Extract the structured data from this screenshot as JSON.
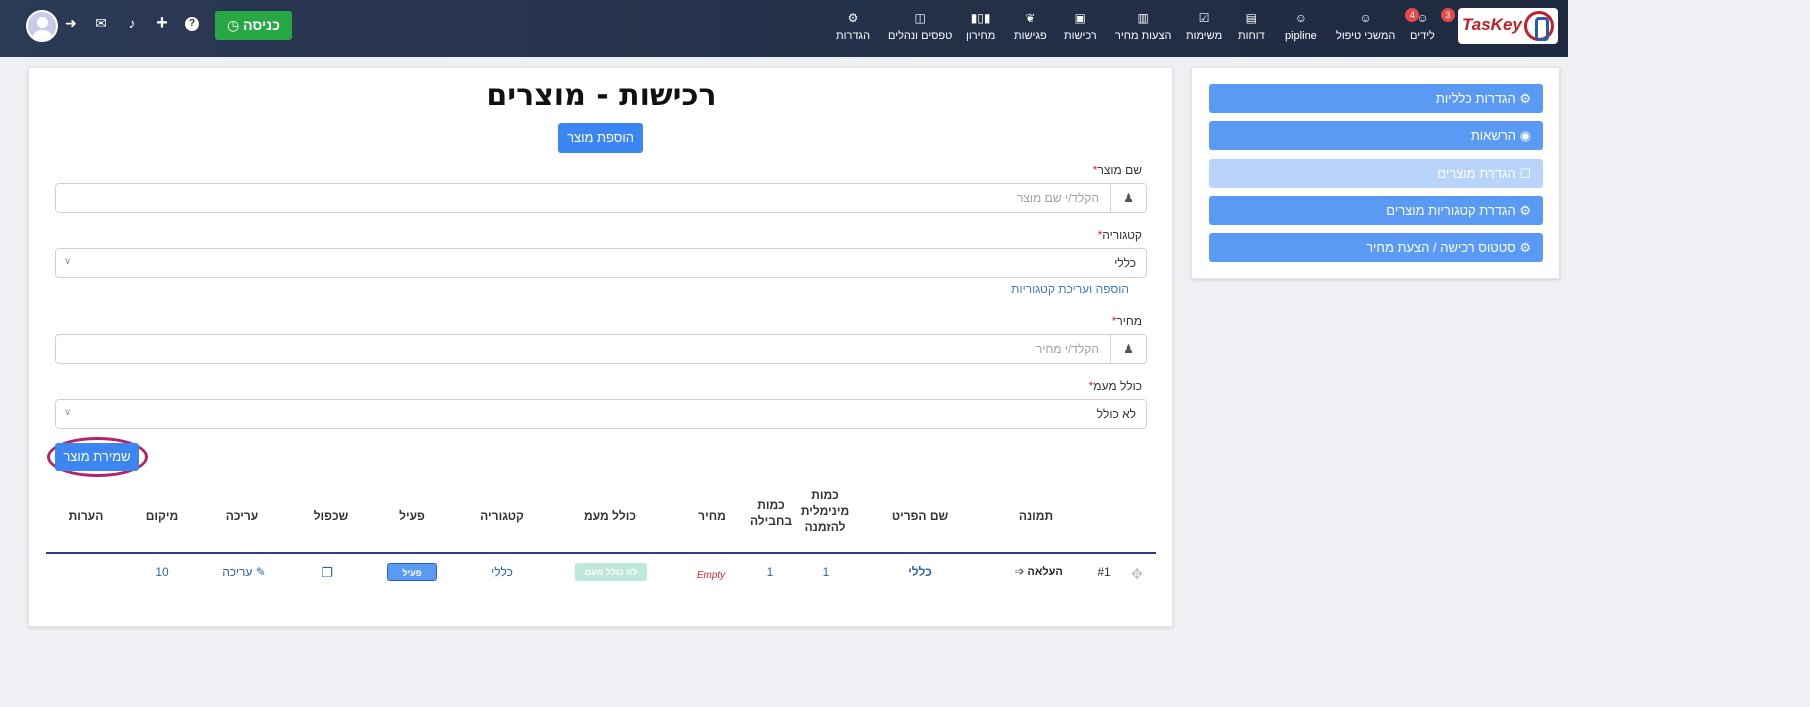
{
  "brand": {
    "logo_text": "TasKey"
  },
  "nav": {
    "items": [
      {
        "label": "לידים",
        "icon": "user-tie-icon",
        "badge": "3"
      },
      {
        "label": "המשכי טיפול",
        "icon": "user-tie-icon",
        "badge": "4"
      },
      {
        "label": "pipline",
        "icon": "user-tie-icon"
      },
      {
        "label": "דוחות",
        "icon": "bar-chart-icon"
      },
      {
        "label": "משימות",
        "icon": "checkbox-icon"
      },
      {
        "label": "הצעות מחיר",
        "icon": "document-icon"
      },
      {
        "label": "רכישות",
        "icon": "industry-icon"
      },
      {
        "label": "פגישות",
        "icon": "handshake-icon"
      },
      {
        "label": "מחירון",
        "icon": "barcode-icon"
      },
      {
        "label": "טפסים ונהלים",
        "icon": "door-icon"
      },
      {
        "label": "הגדרות",
        "icon": "gear-icon"
      }
    ],
    "enter_label": "כניסה"
  },
  "sidebar": {
    "buttons": [
      {
        "label": "הגדרות כלליות",
        "icon": "gear-icon",
        "disabled": false
      },
      {
        "label": "הרשאות",
        "icon": "eye-slash-icon",
        "disabled": false
      },
      {
        "label": "הגדרת מוצרים",
        "icon": "cart-icon",
        "disabled": true
      },
      {
        "label": "הגדרת קטגוריות מוצרים",
        "icon": "gear-icon",
        "disabled": false
      },
      {
        "label": "סטטוס רכישה / הצעת מחיר",
        "icon": "gear-icon",
        "disabled": false
      }
    ]
  },
  "main": {
    "title": "רכישות - מוצרים",
    "add_product_label": "הוספת מוצר",
    "fields": {
      "product_name": {
        "label": "שם מוצר",
        "placeholder": "הקלד/י שם מוצר"
      },
      "category": {
        "label": "קטגוריה",
        "value": "כללי"
      },
      "category_link": "הוספה ועריכת קטגוריות",
      "price": {
        "label": "מחיר",
        "placeholder": "הקלד/י מחיר"
      },
      "vat": {
        "label": "כולל מעמ",
        "value": "לא כולל"
      }
    },
    "save_label": "שמירת מוצר"
  },
  "table": {
    "headers": {
      "image": "תמונה",
      "name": "שם הפריט",
      "min_qty_1": "כמות",
      "min_qty_2": "מינימלית",
      "min_qty_3": "להזמנה",
      "pack_qty_1": "כמות",
      "pack_qty_2": "בחבילה",
      "price": "מחיר",
      "vat": "כולל מעמ",
      "category": "קטגוריה",
      "active": "פעיל",
      "duplicate": "שכפול",
      "edit": "עריכה",
      "position": "מיקום",
      "notes": "הערות"
    },
    "rows": [
      {
        "index": "#1",
        "upload": "העלאה",
        "name": "כללי",
        "min_qty": "1",
        "pack_qty": "1",
        "price": "Empty",
        "vat": "לא כולל מעמ",
        "category": "כללי",
        "active": "פעיל",
        "edit": "עריכה",
        "position": "10"
      }
    ]
  }
}
